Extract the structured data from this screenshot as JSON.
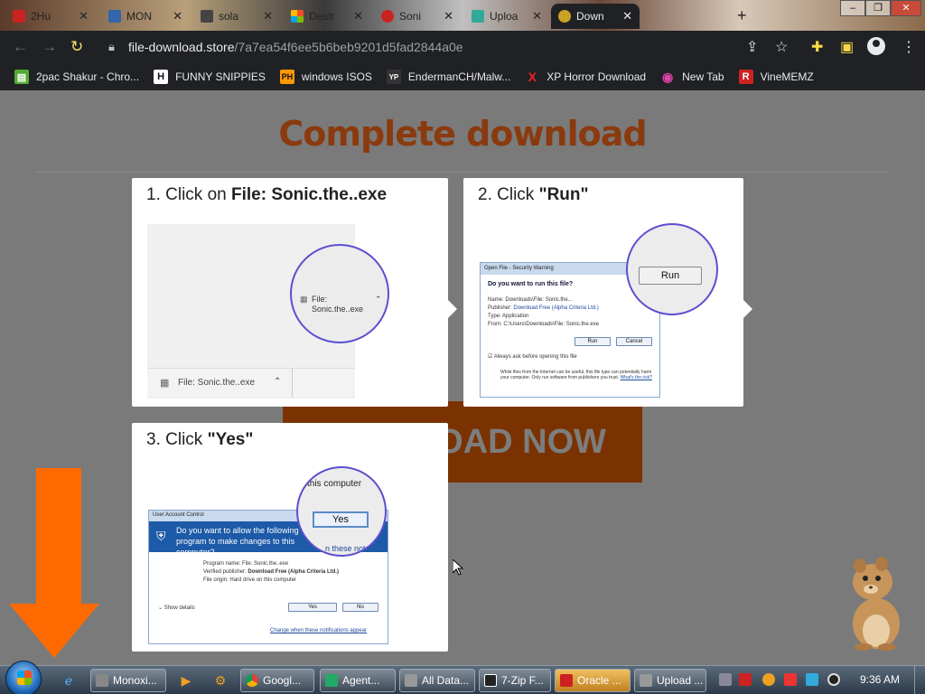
{
  "browser": {
    "tabs": [
      {
        "label": "2Hu",
        "color": "#c22"
      },
      {
        "label": "MON",
        "color": "#3366aa"
      },
      {
        "label": "sola",
        "color": "#444"
      },
      {
        "label": "Destr",
        "color": "#f25022"
      },
      {
        "label": "Soni",
        "color": "#c22"
      },
      {
        "label": "Uploa",
        "color": "#3a9"
      },
      {
        "label": "Down",
        "color": "#c9a227"
      }
    ],
    "active_tab_index": 6,
    "new_tab": "+",
    "window_buttons": [
      "–",
      "❐",
      "✕"
    ],
    "url_host": "file-download.store",
    "url_path": "/7a7ea54f6ee5b6beb9201d5fad2844a0e"
  },
  "bookmarks": [
    {
      "label": "2pac Shakur - Chro...",
      "icon": "H",
      "color": "#5a3"
    },
    {
      "label": "FUNNY SNIPPIES",
      "icon": "H",
      "color": "#222"
    },
    {
      "label": "windows ISOS",
      "icon": "PH",
      "color": "#f90"
    },
    {
      "label": "EndermanCH/Malw...",
      "icon": "YP",
      "color": "#333"
    },
    {
      "label": "XP Horror Download",
      "icon": "X",
      "color": "#d22"
    },
    {
      "label": "New Tab",
      "icon": "◉",
      "color": "#a06"
    },
    {
      "label": "VineMEMZ",
      "icon": "R",
      "color": "#c22"
    }
  ],
  "page": {
    "title": "Complete download",
    "download_button": "LOAD NOW",
    "step1": {
      "prefix": "1. Click on ",
      "bold": "File: Sonic.the..exe",
      "bar_label": "File: Sonic.the..exe",
      "circle_line1": "File:",
      "circle_line2": "Sonic.the..exe"
    },
    "step2": {
      "prefix": "2. Click ",
      "bold": "\"Run\"",
      "dialog_title": "Open File - Security Warning",
      "question": "Do you want to run this file?",
      "name_label": "Name:",
      "name_value": "Downloads\\File: Sonic.the...",
      "publisher_label": "Publisher:",
      "publisher_value": "Download Free (Alpha Criteria Ltd.)",
      "type_label": "Type:",
      "type_value": "Application",
      "from_label": "From:",
      "from_value": "C:\\Users\\Downloads\\File: Sonic.the.exe",
      "run": "Run",
      "cancel": "Cancel",
      "always_ask": "Always ask before opening this file",
      "warning": "While files from the Internet can be useful, this file type can potentially harm your computer. Only run software from publishers you trust.",
      "warning_link": "What's the risk?"
    },
    "step3": {
      "prefix": "3. Click ",
      "bold": "\"Yes\"",
      "dialog_title": "User Account Control",
      "question": "Do you want to allow the following program to make changes to this computer?",
      "program_label": "Program name:",
      "program_value": "File: Sonic.the..exe",
      "publisher_label": "Verified publisher:",
      "publisher_value": "Download Free (Alpha Criteria Ltd.)",
      "origin_label": "File origin:",
      "origin_value": "Hard drive on this computer",
      "show_details": "Show details",
      "yes": "Yes",
      "no": "No",
      "notif_link": "Change when these notifications appear",
      "circle_top": "this computer",
      "circle_link": "n these not"
    }
  },
  "taskbar": {
    "items": [
      {
        "label": "Monoxi...",
        "color": "#888"
      },
      {
        "label": "Googl...",
        "color": "#4285f4"
      },
      {
        "label": "Agent...",
        "color": "#2a6"
      },
      {
        "label": "All Data...",
        "color": "#999"
      },
      {
        "label": "7-Zip F...",
        "color": "#222"
      },
      {
        "label": "Oracle ...",
        "color": "#c22"
      },
      {
        "label": "Upload ...",
        "color": "#999"
      }
    ],
    "active_index": 5,
    "clock": "9:36 AM"
  },
  "colors": {
    "accent_orange": "#ff6a00",
    "title_brown": "#8a3a0e",
    "circle_purple": "#5b4fcf"
  }
}
